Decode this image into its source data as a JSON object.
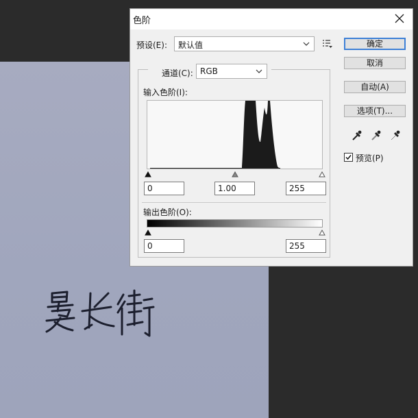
{
  "dialog": {
    "title": "色阶",
    "preset": {
      "label": "预设(E):",
      "value": "默认值"
    },
    "channel": {
      "label": "通道(C):",
      "value": "RGB"
    },
    "input_levels": {
      "label": "输入色阶(I):",
      "black": "0",
      "gamma": "1.00",
      "white": "255"
    },
    "output_levels": {
      "label": "输出色阶(O):",
      "black": "0",
      "white": "255"
    },
    "buttons": {
      "ok": "确定",
      "cancel": "取消",
      "auto": "自动(A)",
      "options": "选项(T)..."
    },
    "preview": {
      "label": "预览(P)",
      "checked": true
    }
  },
  "icons": {
    "close": "close-icon",
    "preset_menu": "preset-options-icon",
    "eyedroppers": [
      "black-point-eyedropper-icon",
      "gray-point-eyedropper-icon",
      "white-point-eyedropper-icon"
    ]
  },
  "canvas": {
    "handwriting": "晏长街"
  }
}
